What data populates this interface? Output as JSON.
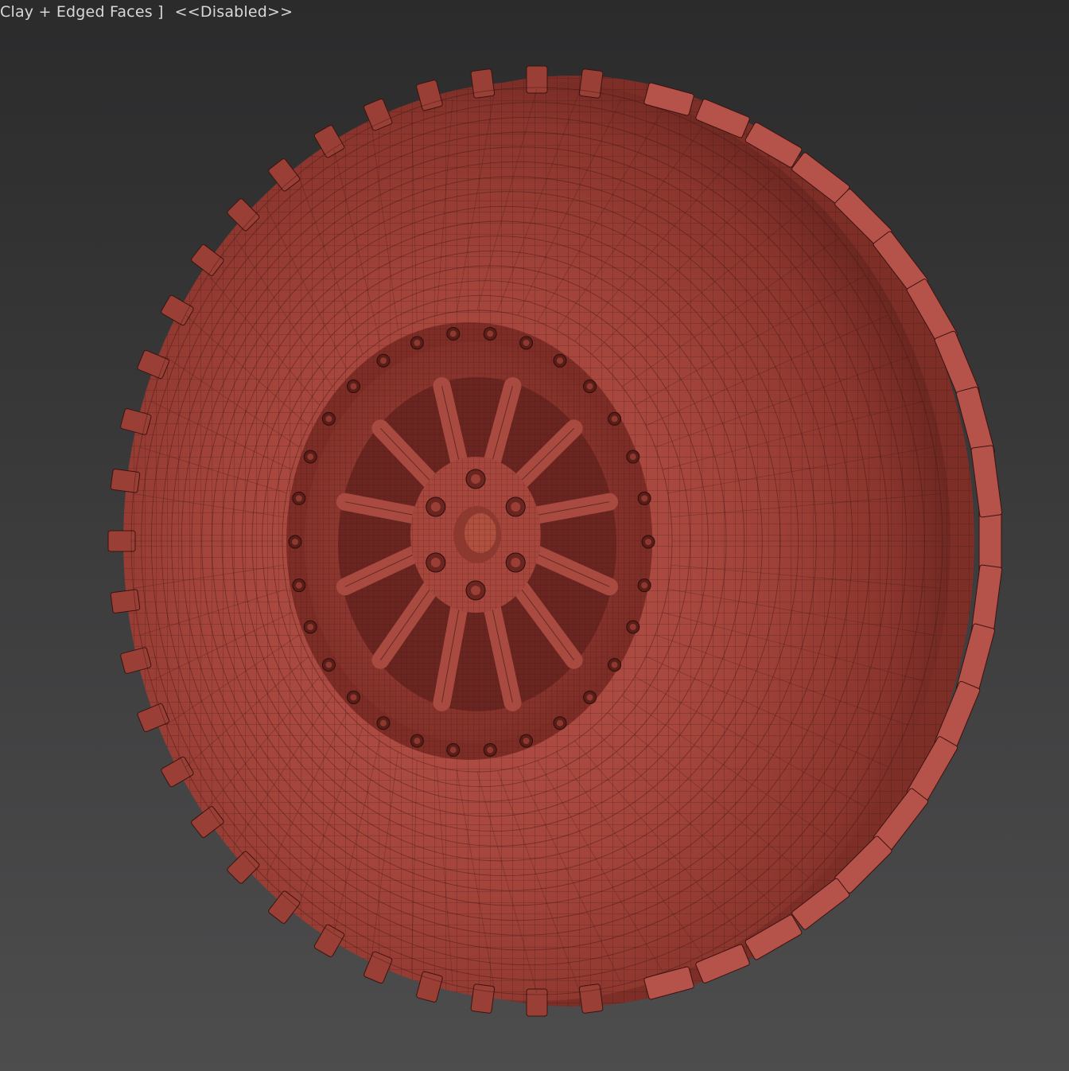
{
  "viewport": {
    "shading_mode_label": "Clay + Edged Faces ]",
    "state_label": "<<Disabled>>",
    "background_color": "#3a3a3b"
  },
  "model": {
    "description_icon": "wheel-mesh",
    "mesh_color": "#a8433a",
    "mesh_shadow_color": "#6e2520",
    "wire_color": "#3b1310"
  }
}
